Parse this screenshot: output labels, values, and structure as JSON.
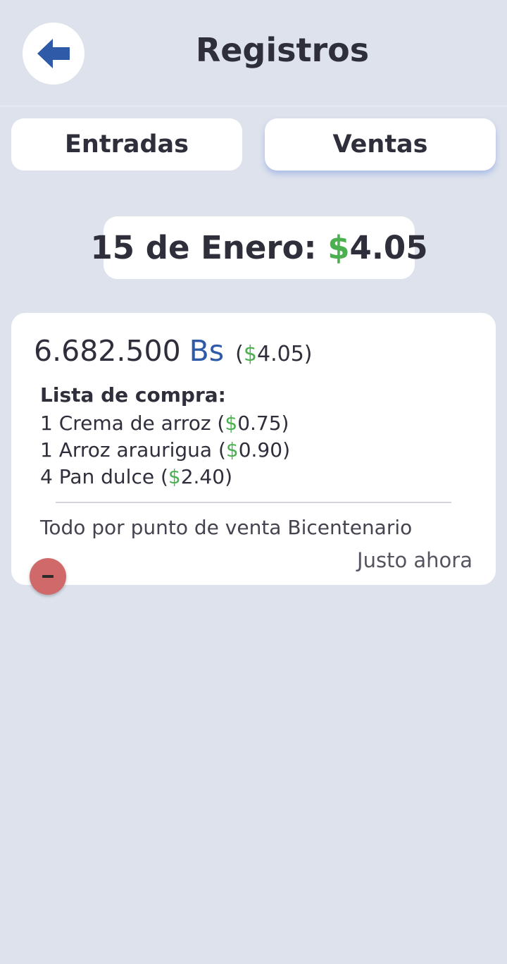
{
  "header": {
    "title": "Registros",
    "back_icon": "arrow-left-icon"
  },
  "tabs": [
    {
      "label": "Entradas",
      "active": false
    },
    {
      "label": "Ventas",
      "active": true
    }
  ],
  "summary": {
    "date_label": "15 de Enero:",
    "currency_symbol": "$",
    "total": "4.05"
  },
  "record": {
    "amount_bs": "6.682.500",
    "bs_label": "Bs",
    "usd_open": "(",
    "usd_symbol": "$",
    "usd_value": "4.05",
    "usd_close": ")",
    "list_title": "Lista de compra:",
    "items": [
      {
        "text": "1 Crema de arroz (",
        "symbol": "$",
        "price": "0.75",
        "close": ")"
      },
      {
        "text": "1 Arroz araurigua (",
        "symbol": "$",
        "price": "0.90",
        "close": ")"
      },
      {
        "text": "4 Pan dulce (",
        "symbol": "$",
        "price": "2.40",
        "close": ")"
      }
    ],
    "note": "Todo por punto de venta Bicentenario",
    "time": "Justo ahora",
    "delete_icon": "minus-icon"
  },
  "colors": {
    "background": "#dde2ec",
    "card": "#ffffff",
    "accent_blue": "#2f5aa8",
    "money_green": "#4caf50",
    "delete_red": "#d06a6a"
  }
}
